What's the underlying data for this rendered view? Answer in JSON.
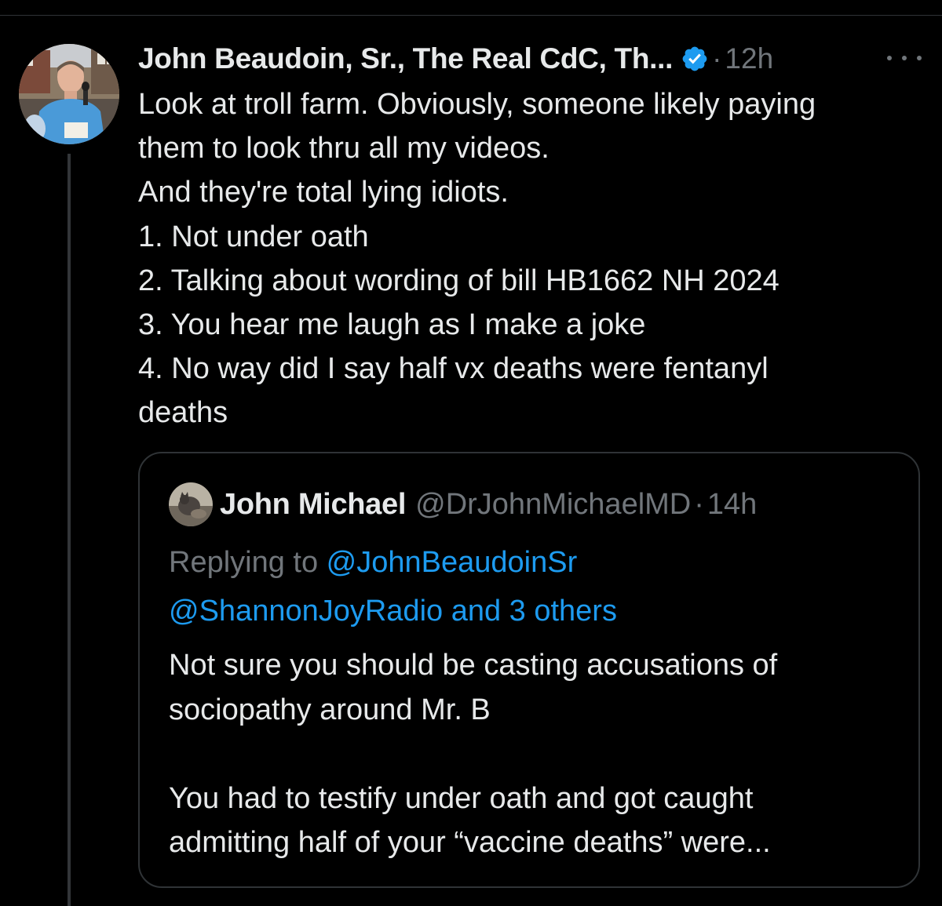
{
  "tweet": {
    "author_name": "John Beaudoin, Sr., The Real CdC, Th...",
    "separator": "·",
    "time": "12h",
    "verified": true,
    "body_lines": [
      "Look at troll farm. Obviously, someone likely paying",
      "them to look thru all my videos.",
      "And they're total lying idiots.",
      "1. Not under oath",
      "2. Talking about wording of bill HB1662 NH 2024",
      "3. You hear me laugh as I make a joke",
      "4. No way did I say half vx deaths were fentanyl",
      "deaths"
    ]
  },
  "quote": {
    "name": "John Michael",
    "handle": "@DrJohnMichaelMD",
    "separator": "·",
    "time": "14h",
    "replying_prefix": "Replying to ",
    "reply_mention_1": "@JohnBeaudoinSr",
    "reply_mention_2": "@ShannonJoyRadio and 3 others",
    "body_lines": [
      "Not sure you should be casting accusations of",
      "sociopathy around Mr. B",
      "",
      "You had to testify under oath and got caught",
      "admitting half of your “vaccine deaths” were..."
    ]
  },
  "colors": {
    "background": "#000000",
    "text": "#e7e9ea",
    "muted": "#71767b",
    "link": "#1d9bf0",
    "verified": "#1d9bf0",
    "border": "#2f3336"
  },
  "icons": {
    "verified": "verified-badge-icon",
    "more": "more-options-icon"
  }
}
